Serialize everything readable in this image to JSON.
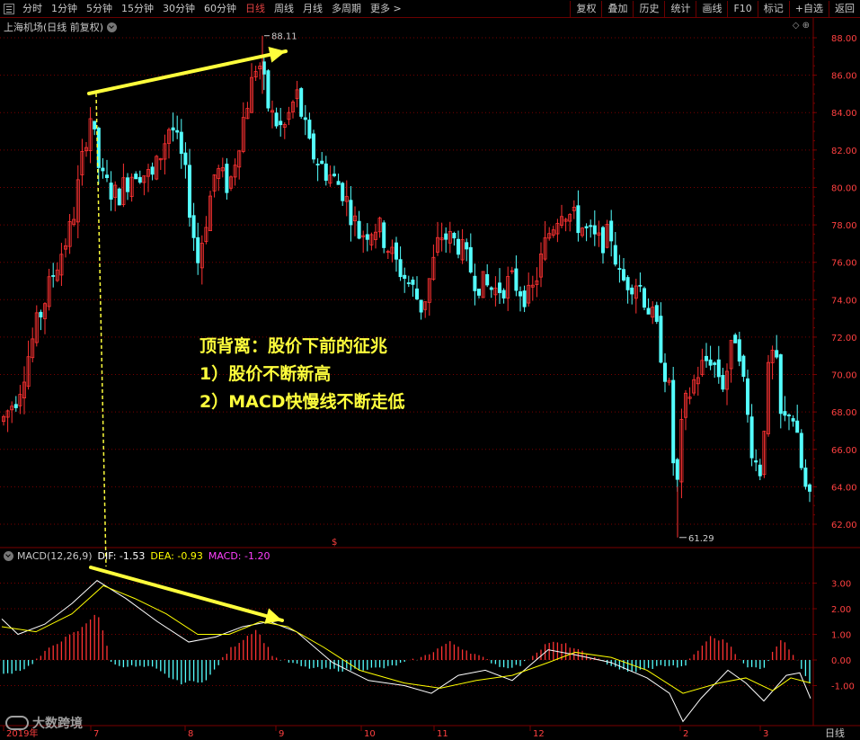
{
  "toolbar": {
    "periods": [
      "分时",
      "1分钟",
      "5分钟",
      "15分钟",
      "30分钟",
      "60分钟",
      "日线",
      "周线",
      "月线",
      "多周期",
      "更多 >"
    ],
    "active_period": "日线",
    "right_buttons": [
      "复权",
      "叠加",
      "历史",
      "统计",
      "画线",
      "F10",
      "标记",
      "+自选",
      "返回"
    ]
  },
  "main": {
    "title": "上海机场(日线 前复权)",
    "high_label": "88.11",
    "low_label": "61.29",
    "corner_icons": "◇ ⊕",
    "y_ticks": [
      "88.00",
      "86.00",
      "84.00",
      "82.00",
      "80.00",
      "78.00",
      "76.00",
      "74.00",
      "72.00",
      "70.00",
      "68.00",
      "66.00",
      "64.00",
      "62.00"
    ],
    "marker_s": "$"
  },
  "macd": {
    "name": "MACD(12,26,9)",
    "dif": "DIF: -1.53",
    "dea": "DEA: -0.93",
    "macd": "MACD: -1.20",
    "y_ticks": [
      "3.00",
      "2.00",
      "1.00",
      "0.00",
      "-1.00"
    ]
  },
  "x_axis": {
    "labels": [
      "2019年",
      "7",
      "8",
      "9",
      "10",
      "11",
      "12",
      "2",
      "3"
    ],
    "period_label": "日线"
  },
  "annotation": {
    "line1": "顶背离：股价下前的征兆",
    "line2": "1）股价不断新高",
    "line3": "2）MACD快慢线不断走低"
  },
  "watermark": "大数跨境",
  "colors": {
    "up": "#ff3232",
    "down": "#54ffff",
    "grid": "#7a0000",
    "annotation": "#ffff3c",
    "dif": "#ffffff",
    "dea": "#ffff00",
    "macd_label": "#ff40ff"
  }
}
